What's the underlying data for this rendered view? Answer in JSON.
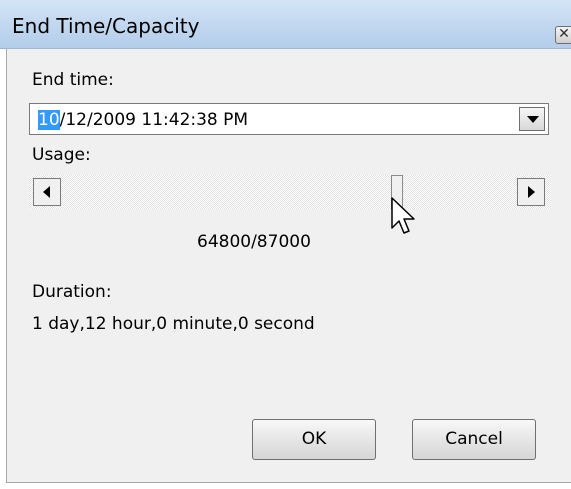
{
  "window": {
    "title": "End Time/Capacity",
    "close_glyph": "✕"
  },
  "end_time": {
    "label": "End time:",
    "value_selected": "10",
    "value_rest": "/12/2009 11:42:38 PM",
    "selection_color": "#3399ff"
  },
  "usage": {
    "label": "Usage:",
    "current": 64800,
    "max": 87000,
    "display": "64800/87000"
  },
  "duration": {
    "label": "Duration:",
    "value": "1 day,12 hour,0 minute,0 second"
  },
  "buttons": {
    "ok": "OK",
    "cancel": "Cancel"
  },
  "icons": {
    "dropdown": "chevron-down-icon",
    "scroll_left": "arrow-left-icon",
    "scroll_right": "arrow-right-icon",
    "cursor": "mouse-pointer-icon"
  }
}
